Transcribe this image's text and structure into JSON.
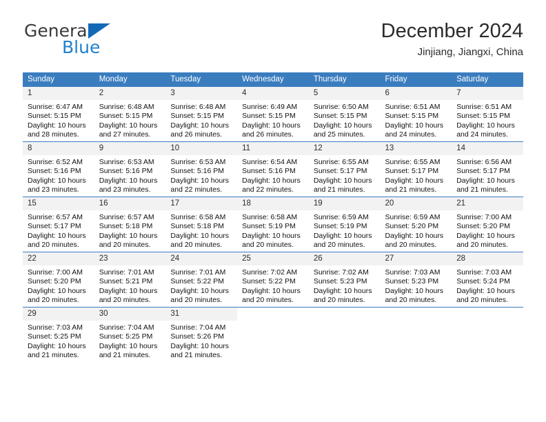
{
  "brand": {
    "name_part1": "General",
    "name_part2": "Blue",
    "accent_color": "#1f81cc",
    "triangle_color": "#1469b6"
  },
  "header": {
    "title": "December 2024",
    "subtitle": "Jinjiang, Jiangxi, China"
  },
  "calendar": {
    "header_bg": "#3a7dbf",
    "daynum_bg": "#f2f2f2",
    "weekday_headers": [
      "Sunday",
      "Monday",
      "Tuesday",
      "Wednesday",
      "Thursday",
      "Friday",
      "Saturday"
    ],
    "weeks": [
      [
        {
          "day": "1",
          "sunrise": "Sunrise: 6:47 AM",
          "sunset": "Sunset: 5:15 PM",
          "daylight": "Daylight: 10 hours and 28 minutes."
        },
        {
          "day": "2",
          "sunrise": "Sunrise: 6:48 AM",
          "sunset": "Sunset: 5:15 PM",
          "daylight": "Daylight: 10 hours and 27 minutes."
        },
        {
          "day": "3",
          "sunrise": "Sunrise: 6:48 AM",
          "sunset": "Sunset: 5:15 PM",
          "daylight": "Daylight: 10 hours and 26 minutes."
        },
        {
          "day": "4",
          "sunrise": "Sunrise: 6:49 AM",
          "sunset": "Sunset: 5:15 PM",
          "daylight": "Daylight: 10 hours and 26 minutes."
        },
        {
          "day": "5",
          "sunrise": "Sunrise: 6:50 AM",
          "sunset": "Sunset: 5:15 PM",
          "daylight": "Daylight: 10 hours and 25 minutes."
        },
        {
          "day": "6",
          "sunrise": "Sunrise: 6:51 AM",
          "sunset": "Sunset: 5:15 PM",
          "daylight": "Daylight: 10 hours and 24 minutes."
        },
        {
          "day": "7",
          "sunrise": "Sunrise: 6:51 AM",
          "sunset": "Sunset: 5:15 PM",
          "daylight": "Daylight: 10 hours and 24 minutes."
        }
      ],
      [
        {
          "day": "8",
          "sunrise": "Sunrise: 6:52 AM",
          "sunset": "Sunset: 5:16 PM",
          "daylight": "Daylight: 10 hours and 23 minutes."
        },
        {
          "day": "9",
          "sunrise": "Sunrise: 6:53 AM",
          "sunset": "Sunset: 5:16 PM",
          "daylight": "Daylight: 10 hours and 23 minutes."
        },
        {
          "day": "10",
          "sunrise": "Sunrise: 6:53 AM",
          "sunset": "Sunset: 5:16 PM",
          "daylight": "Daylight: 10 hours and 22 minutes."
        },
        {
          "day": "11",
          "sunrise": "Sunrise: 6:54 AM",
          "sunset": "Sunset: 5:16 PM",
          "daylight": "Daylight: 10 hours and 22 minutes."
        },
        {
          "day": "12",
          "sunrise": "Sunrise: 6:55 AM",
          "sunset": "Sunset: 5:17 PM",
          "daylight": "Daylight: 10 hours and 21 minutes."
        },
        {
          "day": "13",
          "sunrise": "Sunrise: 6:55 AM",
          "sunset": "Sunset: 5:17 PM",
          "daylight": "Daylight: 10 hours and 21 minutes."
        },
        {
          "day": "14",
          "sunrise": "Sunrise: 6:56 AM",
          "sunset": "Sunset: 5:17 PM",
          "daylight": "Daylight: 10 hours and 21 minutes."
        }
      ],
      [
        {
          "day": "15",
          "sunrise": "Sunrise: 6:57 AM",
          "sunset": "Sunset: 5:17 PM",
          "daylight": "Daylight: 10 hours and 20 minutes."
        },
        {
          "day": "16",
          "sunrise": "Sunrise: 6:57 AM",
          "sunset": "Sunset: 5:18 PM",
          "daylight": "Daylight: 10 hours and 20 minutes."
        },
        {
          "day": "17",
          "sunrise": "Sunrise: 6:58 AM",
          "sunset": "Sunset: 5:18 PM",
          "daylight": "Daylight: 10 hours and 20 minutes."
        },
        {
          "day": "18",
          "sunrise": "Sunrise: 6:58 AM",
          "sunset": "Sunset: 5:19 PM",
          "daylight": "Daylight: 10 hours and 20 minutes."
        },
        {
          "day": "19",
          "sunrise": "Sunrise: 6:59 AM",
          "sunset": "Sunset: 5:19 PM",
          "daylight": "Daylight: 10 hours and 20 minutes."
        },
        {
          "day": "20",
          "sunrise": "Sunrise: 6:59 AM",
          "sunset": "Sunset: 5:20 PM",
          "daylight": "Daylight: 10 hours and 20 minutes."
        },
        {
          "day": "21",
          "sunrise": "Sunrise: 7:00 AM",
          "sunset": "Sunset: 5:20 PM",
          "daylight": "Daylight: 10 hours and 20 minutes."
        }
      ],
      [
        {
          "day": "22",
          "sunrise": "Sunrise: 7:00 AM",
          "sunset": "Sunset: 5:20 PM",
          "daylight": "Daylight: 10 hours and 20 minutes."
        },
        {
          "day": "23",
          "sunrise": "Sunrise: 7:01 AM",
          "sunset": "Sunset: 5:21 PM",
          "daylight": "Daylight: 10 hours and 20 minutes."
        },
        {
          "day": "24",
          "sunrise": "Sunrise: 7:01 AM",
          "sunset": "Sunset: 5:22 PM",
          "daylight": "Daylight: 10 hours and 20 minutes."
        },
        {
          "day": "25",
          "sunrise": "Sunrise: 7:02 AM",
          "sunset": "Sunset: 5:22 PM",
          "daylight": "Daylight: 10 hours and 20 minutes."
        },
        {
          "day": "26",
          "sunrise": "Sunrise: 7:02 AM",
          "sunset": "Sunset: 5:23 PM",
          "daylight": "Daylight: 10 hours and 20 minutes."
        },
        {
          "day": "27",
          "sunrise": "Sunrise: 7:03 AM",
          "sunset": "Sunset: 5:23 PM",
          "daylight": "Daylight: 10 hours and 20 minutes."
        },
        {
          "day": "28",
          "sunrise": "Sunrise: 7:03 AM",
          "sunset": "Sunset: 5:24 PM",
          "daylight": "Daylight: 10 hours and 20 minutes."
        }
      ],
      [
        {
          "day": "29",
          "sunrise": "Sunrise: 7:03 AM",
          "sunset": "Sunset: 5:25 PM",
          "daylight": "Daylight: 10 hours and 21 minutes."
        },
        {
          "day": "30",
          "sunrise": "Sunrise: 7:04 AM",
          "sunset": "Sunset: 5:25 PM",
          "daylight": "Daylight: 10 hours and 21 minutes."
        },
        {
          "day": "31",
          "sunrise": "Sunrise: 7:04 AM",
          "sunset": "Sunset: 5:26 PM",
          "daylight": "Daylight: 10 hours and 21 minutes."
        },
        {
          "day": "",
          "sunrise": "",
          "sunset": "",
          "daylight": ""
        },
        {
          "day": "",
          "sunrise": "",
          "sunset": "",
          "daylight": ""
        },
        {
          "day": "",
          "sunrise": "",
          "sunset": "",
          "daylight": ""
        },
        {
          "day": "",
          "sunrise": "",
          "sunset": "",
          "daylight": ""
        }
      ]
    ]
  }
}
